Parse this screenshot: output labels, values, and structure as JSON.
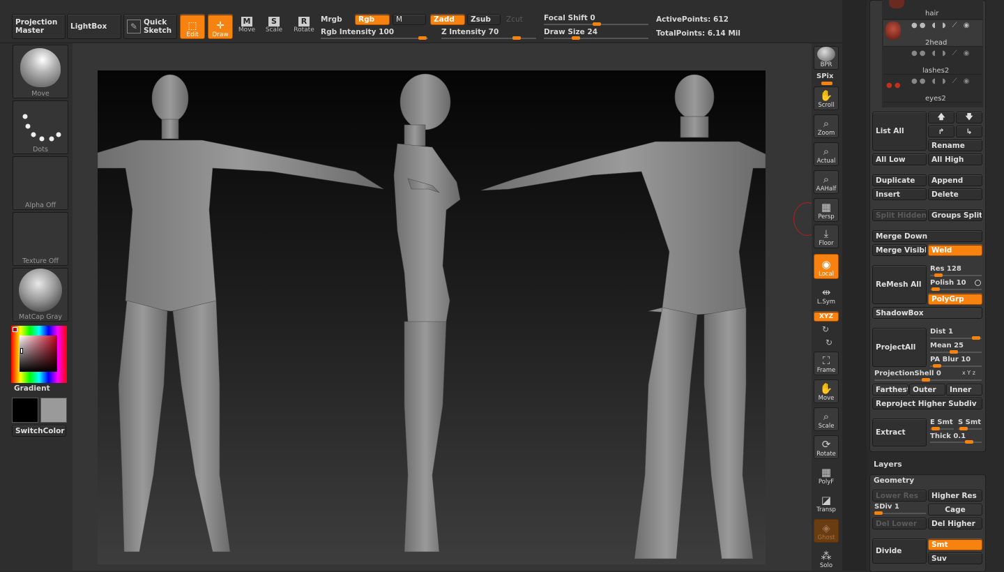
{
  "top": {
    "projection_master": "Projection\nMaster",
    "lightbox": "LightBox",
    "quick_sketch": "Quick\nSketch",
    "edit": "Edit",
    "draw": "Draw",
    "move": "Move",
    "scale": "Scale",
    "rotate": "Rotate",
    "mrgb": "Mrgb",
    "rgb": "Rgb",
    "m": "M",
    "zadd": "Zadd",
    "zsub": "Zsub",
    "zcut": "Zcut",
    "rgb_intensity": "Rgb  Intensity 100",
    "z_intensity": "Z  Intensity 70",
    "focal_shift": "Focal  Shift 0",
    "draw_size": "Draw  Size 24",
    "active_points": "ActivePoints: 612",
    "total_points": "TotalPoints: 6.14  Mil"
  },
  "left": {
    "brush": "Move",
    "stroke": "Dots",
    "alpha": "Alpha  Off",
    "texture": "Texture  Off",
    "material": "MatCap  Gray",
    "gradient": "Gradient",
    "switchcolor": "SwitchColor"
  },
  "right_shelf": {
    "bpr": "BPR",
    "spix": "SPix",
    "scroll": "Scroll",
    "zoom": "Zoom",
    "actual": "Actual",
    "aahalf": "AAHalf",
    "persp": "Persp",
    "floor": "Floor",
    "local": "Local",
    "lsym": "L.Sym",
    "xyz": "XYZ",
    "frame": "Frame",
    "move": "Move",
    "scale": "Scale",
    "rotate": "Rotate",
    "polyf": "PolyF",
    "transp": "Transp",
    "ghost": "Ghost",
    "solo": "Solo"
  },
  "subtools": [
    "hair",
    "2head",
    "lashes2",
    "eyes2"
  ],
  "subtool_panel": {
    "list_all": "List  All",
    "rename": "Rename",
    "all_low": "All  Low",
    "all_high": "All  High",
    "duplicate": "Duplicate",
    "append": "Append",
    "insert": "Insert",
    "delete": "Delete",
    "split_hidden": "Split  Hidden",
    "groups_split": "Groups  Split",
    "merge_down": "Merge  Down",
    "merge_visible": "Merge  Visible",
    "weld": "Weld",
    "remesh_all": "ReMesh  All",
    "res": "Res 128",
    "polish": "Polish 10",
    "polygrp": "PolyGrp",
    "shadowbox": "ShadowBox",
    "project_all": "ProjectAll",
    "dist": "Dist 1",
    "mean": "Mean 25",
    "pa_blur": "PA  Blur 10",
    "projection_shell": "ProjectionShell 0",
    "xyz": "x Y z",
    "farthest": "Farthest",
    "outer": "Outer",
    "inner": "Inner",
    "reproject": "Reproject  Higher  Subdiv",
    "extract": "Extract",
    "e_smt": "E  Smt",
    "s_smt": "S  Smt",
    "thick": "Thick 0.1"
  },
  "layers": "Layers",
  "geometry": {
    "title": "Geometry",
    "lower_res": "Lower  Res",
    "higher_res": "Higher  Res",
    "sdiv": "SDiv 1",
    "cage": "Cage",
    "del_lower": "Del  Lower",
    "del_higher": "Del  Higher",
    "divide": "Divide",
    "smt": "Smt",
    "suv": "Suv"
  },
  "colors": {
    "accent": "#f7820f",
    "panel": "#303030",
    "bg": "#2a2a2a"
  }
}
